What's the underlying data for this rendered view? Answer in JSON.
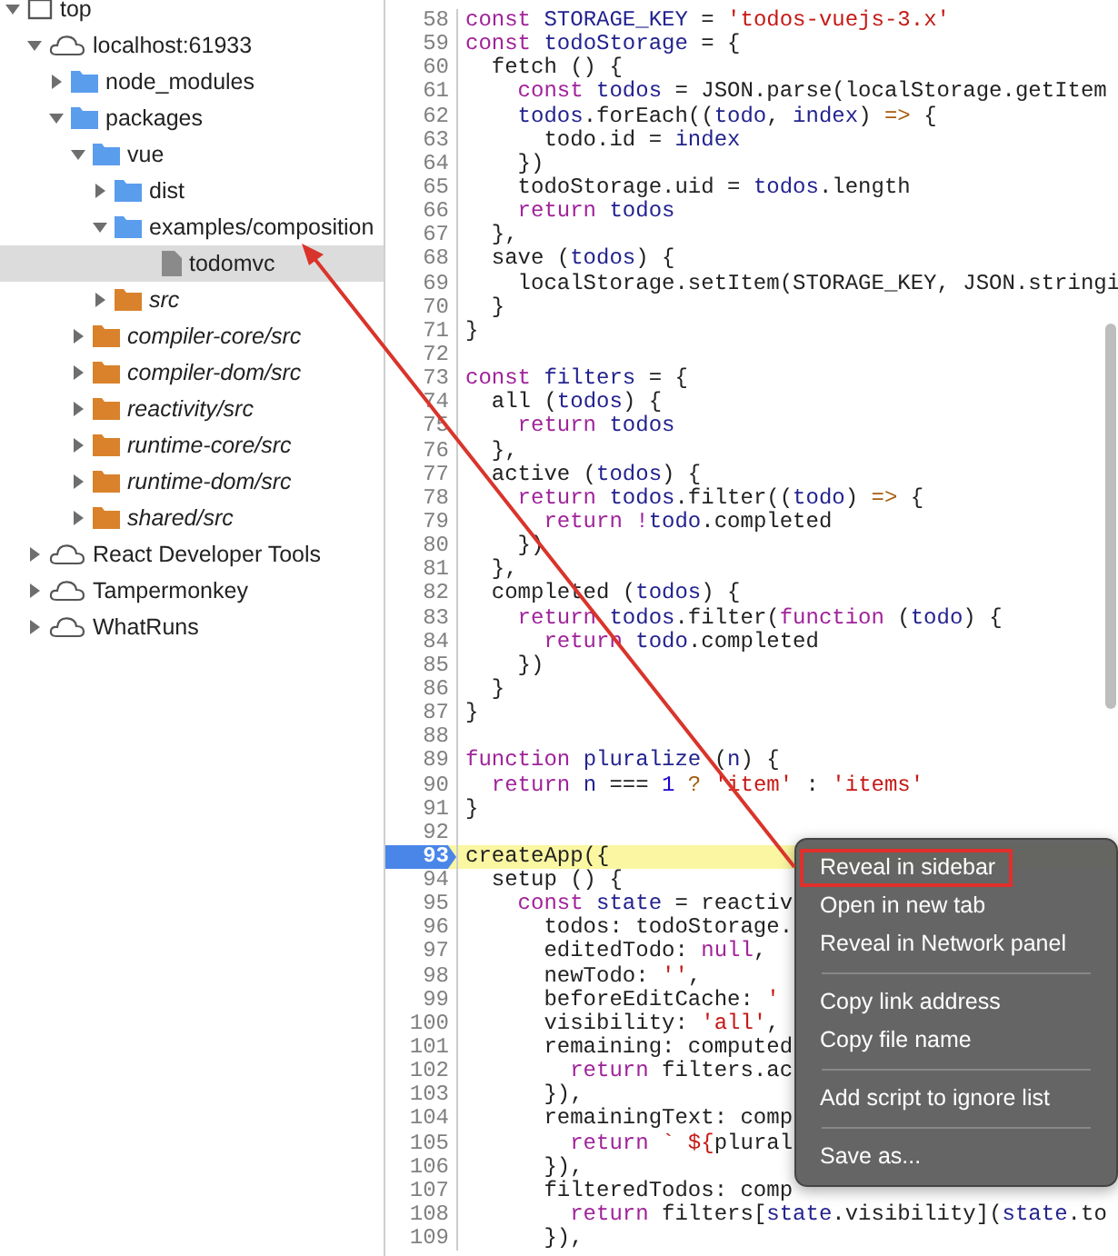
{
  "sidebar": {
    "tree": [
      {
        "label": "top",
        "kind": "frame",
        "expanded": true,
        "selected": false,
        "children": [
          {
            "label": "localhost:61933",
            "kind": "domain",
            "expanded": true,
            "selected": false,
            "children": [
              {
                "label": "node_modules",
                "kind": "folder",
                "expanded": false,
                "selected": false
              },
              {
                "label": "packages",
                "kind": "folder",
                "expanded": true,
                "selected": false,
                "children": [
                  {
                    "label": "vue",
                    "kind": "folder",
                    "expanded": true,
                    "selected": false,
                    "children": [
                      {
                        "label": "dist",
                        "kind": "folder",
                        "expanded": false,
                        "selected": false
                      },
                      {
                        "label": "examples/composition",
                        "kind": "folder",
                        "expanded": true,
                        "selected": false,
                        "children": [
                          {
                            "label": "todomvc",
                            "kind": "file",
                            "selected": true
                          }
                        ]
                      },
                      {
                        "label": "src",
                        "kind": "source-folder",
                        "expanded": false,
                        "selected": false
                      }
                    ]
                  },
                  {
                    "label": "compiler-core/src",
                    "kind": "source-folder",
                    "expanded": false,
                    "selected": false
                  },
                  {
                    "label": "compiler-dom/src",
                    "kind": "source-folder",
                    "expanded": false,
                    "selected": false
                  },
                  {
                    "label": "reactivity/src",
                    "kind": "source-folder",
                    "expanded": false,
                    "selected": false
                  },
                  {
                    "label": "runtime-core/src",
                    "kind": "source-folder",
                    "expanded": false,
                    "selected": false
                  },
                  {
                    "label": "runtime-dom/src",
                    "kind": "source-folder",
                    "expanded": false,
                    "selected": false
                  },
                  {
                    "label": "shared/src",
                    "kind": "source-folder",
                    "expanded": false,
                    "selected": false
                  }
                ]
              }
            ]
          },
          {
            "label": "React Developer Tools",
            "kind": "domain",
            "expanded": false,
            "selected": false
          },
          {
            "label": "Tampermonkey",
            "kind": "domain",
            "expanded": false,
            "selected": false
          },
          {
            "label": "WhatRuns",
            "kind": "domain",
            "expanded": false,
            "selected": false
          }
        ]
      }
    ]
  },
  "editor": {
    "lines": [
      {
        "number": "58",
        "breakpoint": false,
        "highlighted": false,
        "tokens": [
          {
            "kind": "kw",
            "text": "const "
          },
          {
            "kind": "def",
            "text": "STORAGE_KEY"
          },
          {
            "kind": "plain",
            "text": " = "
          },
          {
            "kind": "str",
            "text": "'todos-vuejs-3.x'"
          }
        ]
      },
      {
        "number": "59",
        "breakpoint": false,
        "highlighted": false,
        "tokens": [
          {
            "kind": "kw",
            "text": "const "
          },
          {
            "kind": "def",
            "text": "todoStorage"
          },
          {
            "kind": "plain",
            "text": " = {"
          }
        ]
      },
      {
        "number": "60",
        "breakpoint": false,
        "highlighted": false,
        "tokens": [
          {
            "kind": "plain",
            "text": "  fetch () {"
          }
        ]
      },
      {
        "number": "61",
        "breakpoint": false,
        "highlighted": false,
        "tokens": [
          {
            "kind": "kw",
            "text": "    const "
          },
          {
            "kind": "def",
            "text": "todos"
          },
          {
            "kind": "plain",
            "text": " = JSON.parse(localStorage.getItem"
          }
        ]
      },
      {
        "number": "62",
        "breakpoint": false,
        "highlighted": false,
        "tokens": [
          {
            "kind": "def",
            "text": "    todos"
          },
          {
            "kind": "plain",
            "text": ".forEach(("
          },
          {
            "kind": "def",
            "text": "todo"
          },
          {
            "kind": "plain",
            "text": ", "
          },
          {
            "kind": "def",
            "text": "index"
          },
          {
            "kind": "plain",
            "text": ") "
          },
          {
            "kind": "op",
            "text": "=>"
          },
          {
            "kind": "plain",
            "text": " {"
          }
        ]
      },
      {
        "number": "63",
        "breakpoint": false,
        "highlighted": false,
        "tokens": [
          {
            "kind": "plain",
            "text": "      todo.id = "
          },
          {
            "kind": "def",
            "text": "index"
          }
        ]
      },
      {
        "number": "64",
        "breakpoint": false,
        "highlighted": false,
        "tokens": [
          {
            "kind": "plain",
            "text": "    })"
          }
        ]
      },
      {
        "number": "65",
        "breakpoint": false,
        "highlighted": false,
        "tokens": [
          {
            "kind": "plain",
            "text": "    todoStorage.uid = "
          },
          {
            "kind": "def",
            "text": "todos"
          },
          {
            "kind": "plain",
            "text": ".length"
          }
        ]
      },
      {
        "number": "66",
        "breakpoint": false,
        "highlighted": false,
        "tokens": [
          {
            "kind": "kw",
            "text": "    return "
          },
          {
            "kind": "def",
            "text": "todos"
          }
        ]
      },
      {
        "number": "67",
        "breakpoint": false,
        "highlighted": false,
        "tokens": [
          {
            "kind": "plain",
            "text": "  },"
          }
        ]
      },
      {
        "number": "68",
        "breakpoint": false,
        "highlighted": false,
        "tokens": [
          {
            "kind": "plain",
            "text": "  save ("
          },
          {
            "kind": "def",
            "text": "todos"
          },
          {
            "kind": "plain",
            "text": ") {"
          }
        ]
      },
      {
        "number": "69",
        "breakpoint": false,
        "highlighted": false,
        "tokens": [
          {
            "kind": "plain",
            "text": "    localStorage.setItem(STORAGE_KEY, JSON.stringi"
          }
        ]
      },
      {
        "number": "70",
        "breakpoint": false,
        "highlighted": false,
        "tokens": [
          {
            "kind": "plain",
            "text": "  }"
          }
        ]
      },
      {
        "number": "71",
        "breakpoint": false,
        "highlighted": false,
        "tokens": [
          {
            "kind": "plain",
            "text": "}"
          }
        ]
      },
      {
        "number": "72",
        "breakpoint": false,
        "highlighted": false
      },
      {
        "number": "73",
        "breakpoint": false,
        "highlighted": false,
        "tokens": [
          {
            "kind": "kw",
            "text": "const "
          },
          {
            "kind": "def",
            "text": "filters"
          },
          {
            "kind": "plain",
            "text": " = {"
          }
        ]
      },
      {
        "number": "74",
        "breakpoint": false,
        "highlighted": false,
        "tokens": [
          {
            "kind": "plain",
            "text": "  all ("
          },
          {
            "kind": "def",
            "text": "todos"
          },
          {
            "kind": "plain",
            "text": ") {"
          }
        ]
      },
      {
        "number": "75",
        "breakpoint": false,
        "highlighted": false,
        "tokens": [
          {
            "kind": "kw",
            "text": "    return "
          },
          {
            "kind": "def",
            "text": "todos"
          }
        ]
      },
      {
        "number": "76",
        "breakpoint": false,
        "highlighted": false,
        "tokens": [
          {
            "kind": "plain",
            "text": "  },"
          }
        ]
      },
      {
        "number": "77",
        "breakpoint": false,
        "highlighted": false,
        "tokens": [
          {
            "kind": "plain",
            "text": "  active ("
          },
          {
            "kind": "def",
            "text": "todos"
          },
          {
            "kind": "plain",
            "text": ") {"
          }
        ]
      },
      {
        "number": "78",
        "breakpoint": false,
        "highlighted": false,
        "tokens": [
          {
            "kind": "kw",
            "text": "    return "
          },
          {
            "kind": "def",
            "text": "todos"
          },
          {
            "kind": "plain",
            "text": ".filter(("
          },
          {
            "kind": "def",
            "text": "todo"
          },
          {
            "kind": "plain",
            "text": ") "
          },
          {
            "kind": "op",
            "text": "=>"
          },
          {
            "kind": "plain",
            "text": " {"
          }
        ]
      },
      {
        "number": "79",
        "breakpoint": false,
        "highlighted": false,
        "tokens": [
          {
            "kind": "kw",
            "text": "      return !"
          },
          {
            "kind": "def",
            "text": "todo"
          },
          {
            "kind": "plain",
            "text": ".completed"
          }
        ]
      },
      {
        "number": "80",
        "breakpoint": false,
        "highlighted": false,
        "tokens": [
          {
            "kind": "plain",
            "text": "    })"
          }
        ]
      },
      {
        "number": "81",
        "breakpoint": false,
        "highlighted": false,
        "tokens": [
          {
            "kind": "plain",
            "text": "  },"
          }
        ]
      },
      {
        "number": "82",
        "breakpoint": false,
        "highlighted": false,
        "tokens": [
          {
            "kind": "plain",
            "text": "  completed ("
          },
          {
            "kind": "def",
            "text": "todos"
          },
          {
            "kind": "plain",
            "text": ") {"
          }
        ]
      },
      {
        "number": "83",
        "breakpoint": false,
        "highlighted": false,
        "tokens": [
          {
            "kind": "kw",
            "text": "    return "
          },
          {
            "kind": "def",
            "text": "todos"
          },
          {
            "kind": "plain",
            "text": ".filter("
          },
          {
            "kind": "kw",
            "text": "function "
          },
          {
            "kind": "plain",
            "text": "("
          },
          {
            "kind": "def",
            "text": "todo"
          },
          {
            "kind": "plain",
            "text": ") {"
          }
        ]
      },
      {
        "number": "84",
        "breakpoint": false,
        "highlighted": false,
        "tokens": [
          {
            "kind": "kw",
            "text": "      return "
          },
          {
            "kind": "def",
            "text": "todo"
          },
          {
            "kind": "plain",
            "text": ".completed"
          }
        ]
      },
      {
        "number": "85",
        "breakpoint": false,
        "highlighted": false,
        "tokens": [
          {
            "kind": "plain",
            "text": "    })"
          }
        ]
      },
      {
        "number": "86",
        "breakpoint": false,
        "highlighted": false,
        "tokens": [
          {
            "kind": "plain",
            "text": "  }"
          }
        ]
      },
      {
        "number": "87",
        "breakpoint": false,
        "highlighted": false,
        "tokens": [
          {
            "kind": "plain",
            "text": "}"
          }
        ]
      },
      {
        "number": "88",
        "breakpoint": false,
        "highlighted": false
      },
      {
        "number": "89",
        "breakpoint": false,
        "highlighted": false,
        "tokens": [
          {
            "kind": "kw",
            "text": "function "
          },
          {
            "kind": "def",
            "text": "pluralize"
          },
          {
            "kind": "plain",
            "text": " ("
          },
          {
            "kind": "def",
            "text": "n"
          },
          {
            "kind": "plain",
            "text": ") {"
          }
        ]
      },
      {
        "number": "90",
        "breakpoint": false,
        "highlighted": false,
        "tokens": [
          {
            "kind": "kw",
            "text": "  return "
          },
          {
            "kind": "def",
            "text": "n"
          },
          {
            "kind": "plain",
            "text": " === "
          },
          {
            "kind": "num",
            "text": "1"
          },
          {
            "kind": "op",
            "text": " ? "
          },
          {
            "kind": "str",
            "text": "'item'"
          },
          {
            "kind": "plain",
            "text": " : "
          },
          {
            "kind": "str",
            "text": "'items'"
          }
        ]
      },
      {
        "number": "91",
        "breakpoint": false,
        "highlighted": false,
        "tokens": [
          {
            "kind": "plain",
            "text": "}"
          }
        ]
      },
      {
        "number": "92",
        "breakpoint": false,
        "highlighted": false
      },
      {
        "number": "93",
        "breakpoint": true,
        "highlighted": true,
        "tokens": [
          {
            "kind": "plain",
            "text": "createApp({"
          }
        ]
      },
      {
        "number": "94",
        "breakpoint": false,
        "highlighted": false,
        "tokens": [
          {
            "kind": "plain",
            "text": "  setup () {"
          }
        ]
      },
      {
        "number": "95",
        "breakpoint": false,
        "highlighted": false,
        "tokens": [
          {
            "kind": "kw",
            "text": "    const "
          },
          {
            "kind": "def",
            "text": "state"
          },
          {
            "kind": "plain",
            "text": " = reactiv"
          }
        ]
      },
      {
        "number": "96",
        "breakpoint": false,
        "highlighted": false,
        "tokens": [
          {
            "kind": "plain",
            "text": "      todos: todoStorage."
          }
        ]
      },
      {
        "number": "97",
        "breakpoint": false,
        "highlighted": false,
        "tokens": [
          {
            "kind": "plain",
            "text": "      editedTodo: "
          },
          {
            "kind": "kw",
            "text": "null"
          },
          {
            "kind": "plain",
            "text": ","
          }
        ]
      },
      {
        "number": "98",
        "breakpoint": false,
        "highlighted": false,
        "tokens": [
          {
            "kind": "plain",
            "text": "      newTodo: "
          },
          {
            "kind": "str",
            "text": "''"
          },
          {
            "kind": "plain",
            "text": ","
          }
        ]
      },
      {
        "number": "99",
        "breakpoint": false,
        "highlighted": false,
        "tokens": [
          {
            "kind": "plain",
            "text": "      beforeEditCache: "
          },
          {
            "kind": "str",
            "text": "'"
          }
        ]
      },
      {
        "number": "100",
        "breakpoint": false,
        "highlighted": false,
        "tokens": [
          {
            "kind": "plain",
            "text": "      visibility: "
          },
          {
            "kind": "str",
            "text": "'all'"
          },
          {
            "kind": "plain",
            "text": ","
          }
        ]
      },
      {
        "number": "101",
        "breakpoint": false,
        "highlighted": false,
        "tokens": [
          {
            "kind": "plain",
            "text": "      remaining: computed"
          }
        ]
      },
      {
        "number": "102",
        "breakpoint": false,
        "highlighted": false,
        "tokens": [
          {
            "kind": "kw",
            "text": "        return "
          },
          {
            "kind": "plain",
            "text": "filters.ac"
          }
        ]
      },
      {
        "number": "103",
        "breakpoint": false,
        "highlighted": false,
        "tokens": [
          {
            "kind": "plain",
            "text": "      }),"
          }
        ]
      },
      {
        "number": "104",
        "breakpoint": false,
        "highlighted": false,
        "tokens": [
          {
            "kind": "plain",
            "text": "      remainingText: comp"
          }
        ]
      },
      {
        "number": "105",
        "breakpoint": false,
        "highlighted": false,
        "tokens": [
          {
            "kind": "kw",
            "text": "        return "
          },
          {
            "kind": "str",
            "text": "` ${"
          },
          {
            "kind": "plain",
            "text": "plural"
          }
        ]
      },
      {
        "number": "106",
        "breakpoint": false,
        "highlighted": false,
        "tokens": [
          {
            "kind": "plain",
            "text": "      }),"
          }
        ]
      },
      {
        "number": "107",
        "breakpoint": false,
        "highlighted": false,
        "tokens": [
          {
            "kind": "plain",
            "text": "      filteredTodos: comp"
          }
        ]
      },
      {
        "number": "108",
        "breakpoint": false,
        "highlighted": false,
        "tokens": [
          {
            "kind": "kw",
            "text": "        return "
          },
          {
            "kind": "plain",
            "text": "filters["
          },
          {
            "kind": "def",
            "text": "state"
          },
          {
            "kind": "plain",
            "text": ".visibility]("
          },
          {
            "kind": "def",
            "text": "state"
          },
          {
            "kind": "plain",
            "text": ".to"
          }
        ]
      },
      {
        "number": "109",
        "breakpoint": false,
        "highlighted": false,
        "tokens": [
          {
            "kind": "plain",
            "text": "      }),"
          }
        ]
      }
    ]
  },
  "context_menu": {
    "groups": [
      [
        {
          "label": "Reveal in sidebar",
          "outlined": true
        },
        {
          "label": "Open in new tab",
          "outlined": false
        },
        {
          "label": "Reveal in Network panel",
          "outlined": false
        }
      ],
      [
        {
          "label": "Copy link address",
          "outlined": false
        },
        {
          "label": "Copy file name",
          "outlined": false
        }
      ],
      [
        {
          "label": "Add script to ignore list",
          "outlined": false
        }
      ],
      [
        {
          "label": "Save as...",
          "outlined": false
        }
      ]
    ]
  }
}
